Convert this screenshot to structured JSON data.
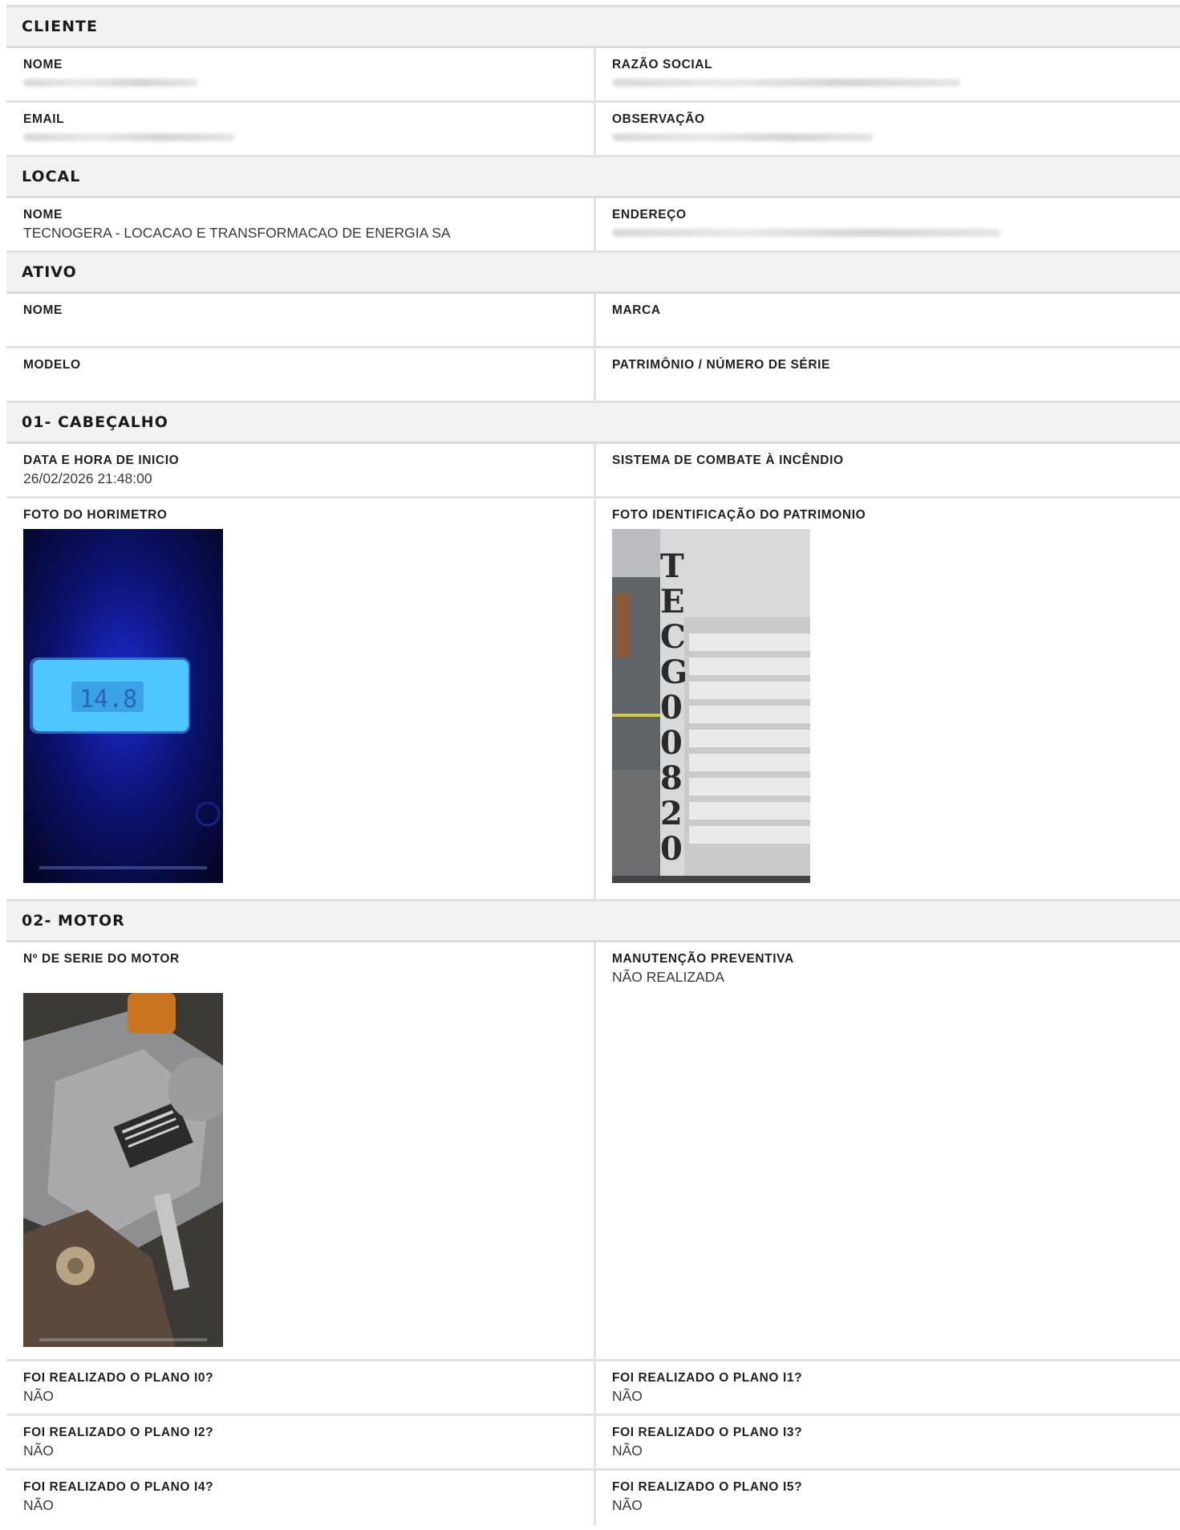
{
  "sections": {
    "cliente": {
      "title": "CLIENTE",
      "nome_label": "NOME",
      "razao_label": "RAZÃO SOCIAL",
      "email_label": "EMAIL",
      "obs_label": "OBSERVAÇÃO"
    },
    "local": {
      "title": "LOCAL",
      "nome_label": "NOME",
      "nome_value": "TECNOGERA - LOCACAO E TRANSFORMACAO DE ENERGIA SA",
      "endereco_label": "ENDEREÇO"
    },
    "ativo": {
      "title": "ATIVO",
      "nome_label": "NOME",
      "marca_label": "MARCA",
      "modelo_label": "MODELO",
      "patrimonio_label": "PATRIMÔNIO / NÚMERO DE SÉRIE"
    },
    "cabecalho": {
      "title": "01- CABEÇALHO",
      "data_label": "DATA E HORA DE INICIO",
      "data_value": "26/02/2026 21:48:00",
      "sistema_label": "SISTEMA DE COMBATE À INCÊNDIO",
      "foto_horimetro_label": "FOTO DO HORIMETRO",
      "foto_patrimonio_label": "FOTO IDENTIFICAÇÃO DO PATRIMONIO"
    },
    "motor": {
      "title": "02- MOTOR",
      "serie_label": "Nº DE SERIE DO MOTOR",
      "manutencao_label": "MANUTENÇÃO PREVENTIVA",
      "manutencao_value": "NÃO REALIZADA",
      "planos": [
        {
          "label": "FOI REALIZADO O PLANO I0?",
          "value": "NÃO"
        },
        {
          "label": "FOI REALIZADO O PLANO I1?",
          "value": "NÃO"
        },
        {
          "label": "FOI REALIZADO O PLANO I2?",
          "value": "NÃO"
        },
        {
          "label": "FOI REALIZADO O PLANO I3?",
          "value": "NÃO"
        },
        {
          "label": "FOI REALIZADO O PLANO I4?",
          "value": "NÃO"
        },
        {
          "label": "FOI REALIZADO O PLANO I5?",
          "value": "NÃO"
        }
      ]
    }
  },
  "photo_text": {
    "patrimonio_stencil": "TECG00820"
  }
}
